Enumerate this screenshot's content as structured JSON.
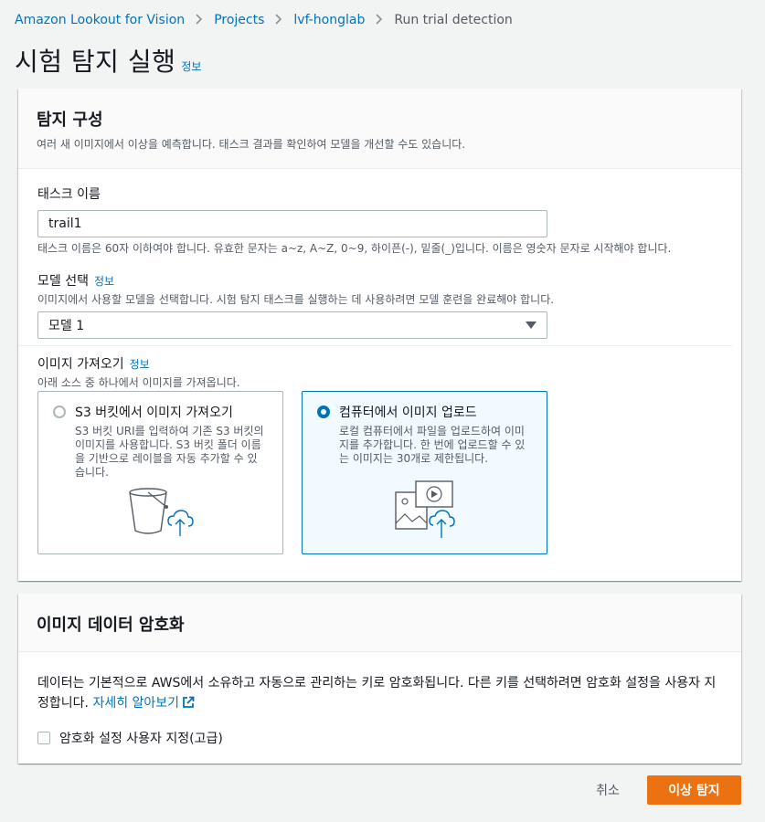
{
  "breadcrumb": {
    "items": [
      "Amazon Lookout for Vision",
      "Projects",
      "lvf-honglab"
    ],
    "current": "Run trial detection"
  },
  "page": {
    "title": "시험 탐지 실행",
    "info": "정보"
  },
  "config": {
    "title": "탐지 구성",
    "description": "여러 새 이미지에서 이상을 예측합니다. 태스크 결과를 확인하여 모델을 개선할 수도 있습니다.",
    "task_name": {
      "label": "태스크 이름",
      "value": "trail1",
      "constraint": "태스크 이름은 60자 이하여야 합니다. 유효한 문자는 a~z, A~Z, 0~9, 하이픈(-), 밑줄(_)입니다. 이름은 영숫자 문자로 시작해야 합니다."
    },
    "model": {
      "label": "모델 선택",
      "info": "정보",
      "description": "이미지에서 사용할 모델을 선택합니다. 시험 탐지 태스크를 실행하는 데 사용하려면 모델 훈련을 완료해야 합니다.",
      "selected": "모델 1"
    },
    "import": {
      "label": "이미지 가져오기",
      "info": "정보",
      "description": "아래 소스 중 하나에서 이미지를 가져옵니다.",
      "options": [
        {
          "title": "S3 버킷에서 이미지 가져오기",
          "description": "S3 버킷 URI를 입력하여 기존 S3 버킷의 이미지를 사용합니다. S3 버킷 폴더 이름을 기반으로 레이블을 자동 추가할 수 있습니다.",
          "selected": false
        },
        {
          "title": "컴퓨터에서 이미지 업로드",
          "description": "로컬 컴퓨터에서 파일을 업로드하여 이미지를 추가합니다. 한 번에 업로드할 수 있는 이미지는 30개로 제한됩니다.",
          "selected": true
        }
      ]
    }
  },
  "encryption": {
    "title": "이미지 데이터 암호화",
    "text": "데이터는 기본적으로 AWS에서 소유하고 자동으로 관리하는 키로 암호화됩니다. 다른 키를 선택하려면 암호화 설정을 사용자 지정합니다.",
    "learn_more": "자세히 알아보기",
    "checkbox_label": "암호화 설정 사용자 지정(고급)",
    "checked": false
  },
  "actions": {
    "cancel": "취소",
    "submit": "이상 탐지"
  },
  "colors": {
    "link": "#0073bb",
    "primary": "#ec7211",
    "selected_bg": "#f1faff"
  }
}
